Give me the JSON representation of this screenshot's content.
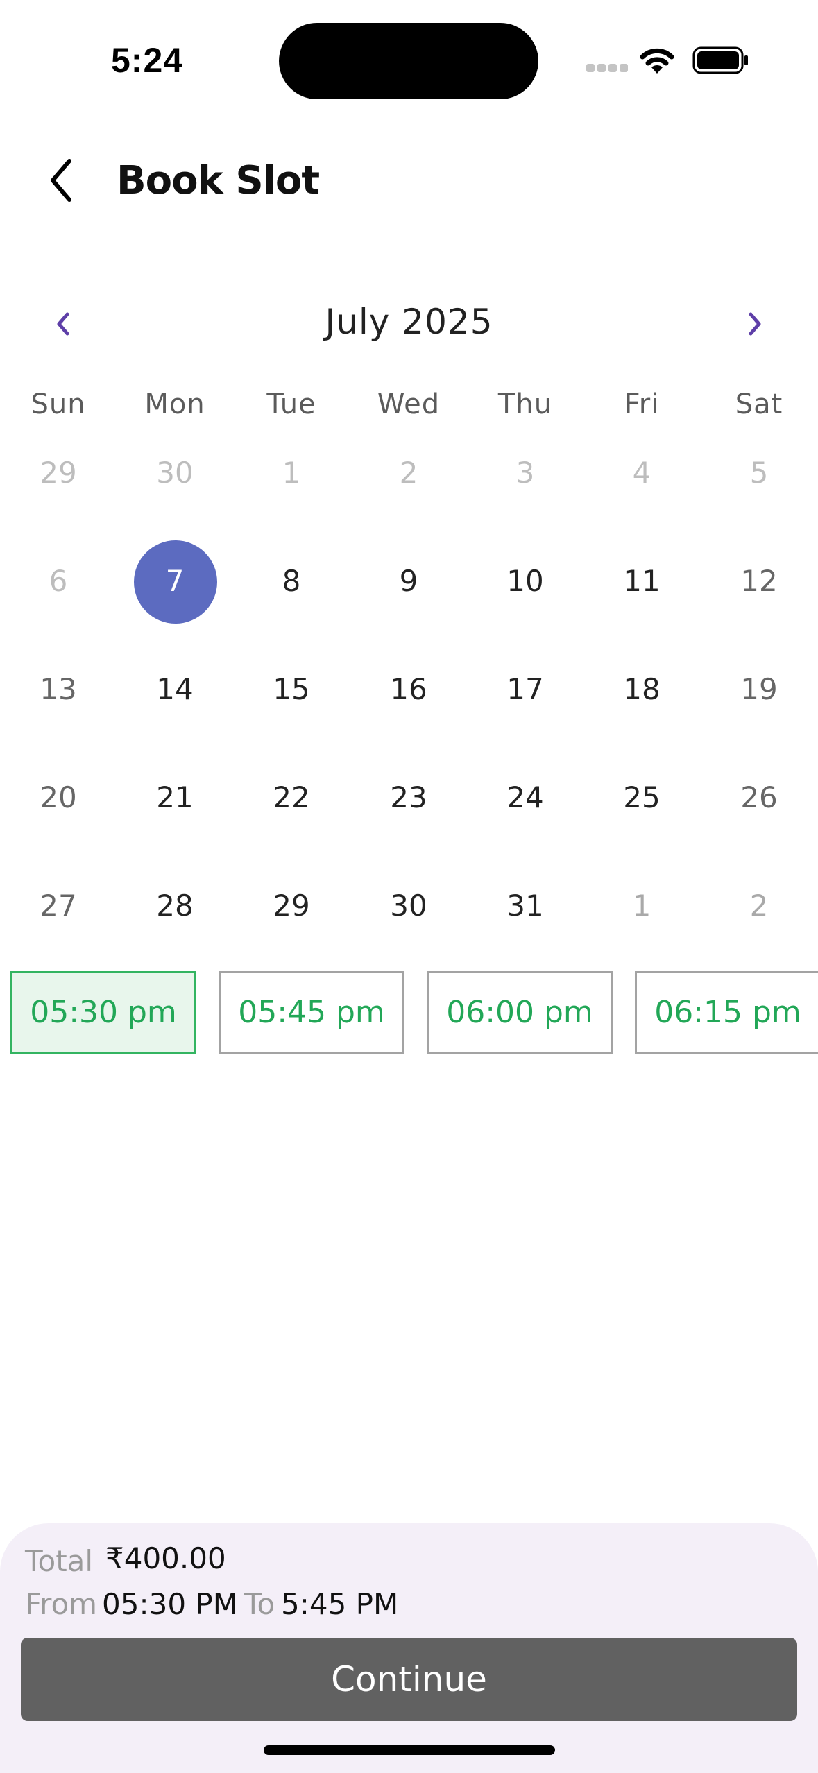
{
  "status_bar": {
    "time": "5:24",
    "icons": [
      "signal-icon",
      "wifi-icon",
      "battery-icon"
    ]
  },
  "header": {
    "back_icon": "back-arrow-icon",
    "title": "Book Slot"
  },
  "calendar": {
    "month_label": "July 2025",
    "prev_icon": "chevron-left-icon",
    "next_icon": "chevron-right-icon",
    "weekdays": [
      "Sun",
      "Mon",
      "Tue",
      "Wed",
      "Thu",
      "Fri",
      "Sat"
    ],
    "weeks": [
      [
        "29",
        "30",
        "1",
        "2",
        "3",
        "4",
        "5"
      ],
      [
        "6",
        "7",
        "8",
        "9",
        "10",
        "11",
        "12"
      ],
      [
        "13",
        "14",
        "15",
        "16",
        "17",
        "18",
        "19"
      ],
      [
        "20",
        "21",
        "22",
        "23",
        "24",
        "25",
        "26"
      ],
      [
        "27",
        "28",
        "29",
        "30",
        "31",
        "1",
        "2"
      ]
    ],
    "selected_day": "7",
    "accent_color": "#5c6bc0"
  },
  "time_slots": {
    "items": [
      "05:30 pm",
      "05:45 pm",
      "06:00 pm",
      "06:15 pm"
    ],
    "selected": "05:30 pm",
    "text_color": "#22a757"
  },
  "summary": {
    "total_label": "Total",
    "total_value": "₹400.00",
    "from_label": "From",
    "from_value": "05:30 PM",
    "to_label": "To",
    "to_value": "5:45 PM"
  },
  "actions": {
    "continue_label": "Continue"
  }
}
